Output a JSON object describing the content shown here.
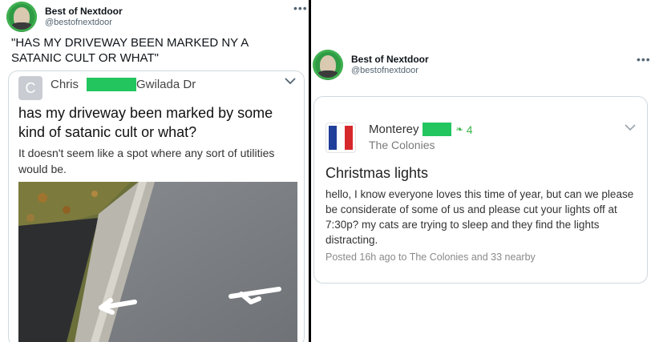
{
  "left_tweet": {
    "account_name": "Best of Nextdoor",
    "handle": "@bestofnextdoor",
    "more_icon": "more-horizontal-icon",
    "text": "\"HAS MY DRIVEWAY BEEN MARKED NY A SATANIC CULT OR WHAT\"",
    "quoted_post": {
      "avatar_letter": "C",
      "user_first": "Chris",
      "user_suffix": "Gwilada Dr",
      "title": "has my driveway been marked by some kind of satanic cult or what?",
      "body": "It doesn't seem like a spot where any sort of utilities would be.",
      "expand_icon": "chevron-down-icon"
    }
  },
  "right_tweet": {
    "account_name": "Best of Nextdoor",
    "handle": "@bestofnextdoor",
    "more_icon": "more-horizontal-icon",
    "nextdoor_post": {
      "user_first": "Monterey",
      "leaf_icon": "leaf-icon",
      "count": "4",
      "neighborhood": "The Colonies",
      "title": "Christmas lights",
      "body": "hello, I know everyone loves this time of year, but can we please be considerate of some of us and please cut your lights off at 7:30p? my cats are trying to sleep and they find the lights distracting.",
      "meta": "Posted 16h ago to The Colonies and 33 nearby",
      "expand_icon": "chevron-down-icon"
    }
  },
  "colors": {
    "redaction_green": "#22c55e",
    "nextdoor_green": "#3bb54a",
    "divider": "#000000"
  }
}
